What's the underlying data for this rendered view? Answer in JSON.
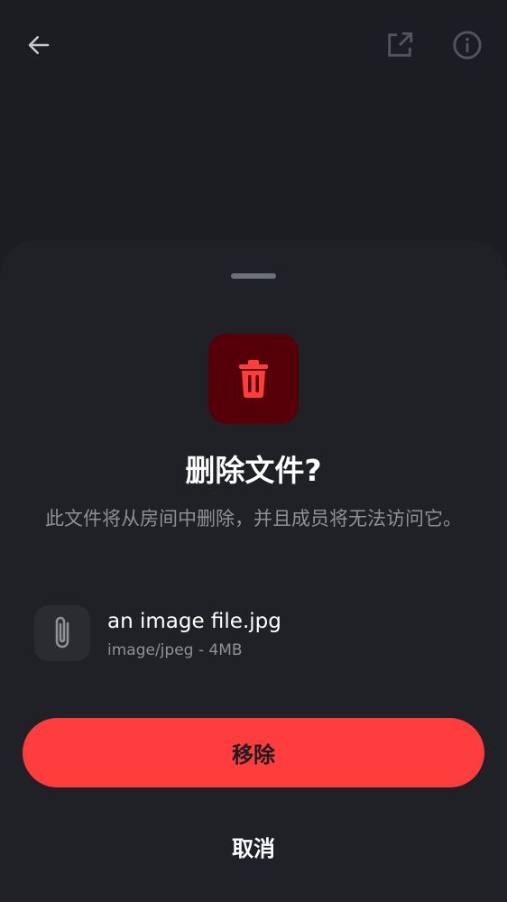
{
  "topbar": {
    "back_icon": "arrow-left-icon",
    "share_icon": "open-external-icon",
    "info_icon": "info-icon"
  },
  "dialog": {
    "icon": "trash-icon",
    "title": "删除文件?",
    "message": "此文件将从房间中删除，并且成员将无法访问它。",
    "file": {
      "icon": "paperclip-icon",
      "name": "an image file.jpg",
      "meta": "image/jpeg - 4MB"
    },
    "remove_label": "移除",
    "cancel_label": "取消"
  },
  "colors": {
    "background": "#1b1d22",
    "danger": "#ff3d3d",
    "danger_tile": "#550009",
    "secondary_text": "#8e9196"
  }
}
